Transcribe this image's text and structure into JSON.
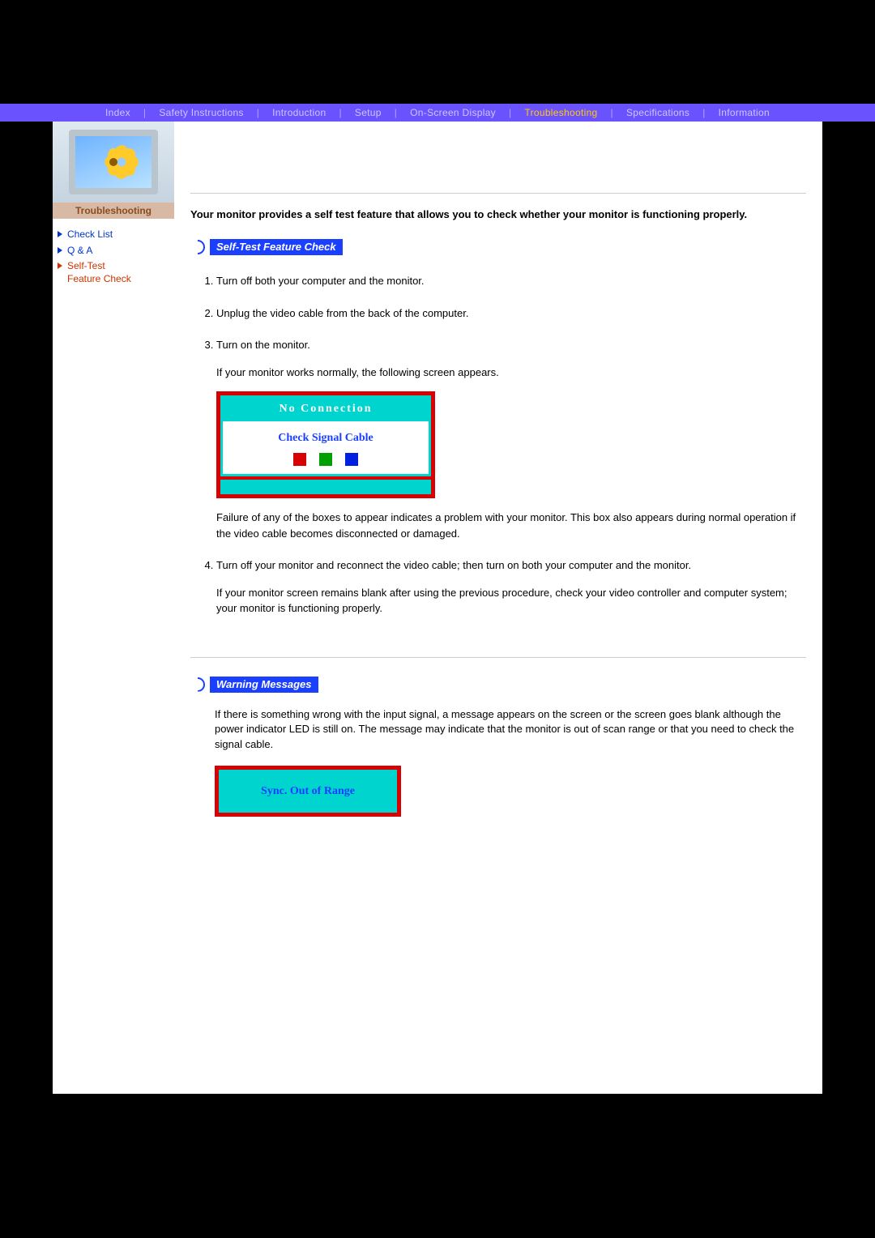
{
  "topnav": {
    "items": [
      {
        "label": "Index"
      },
      {
        "label": "Safety Instructions"
      },
      {
        "label": "Introduction"
      },
      {
        "label": "Setup"
      },
      {
        "label": "On-Screen Display"
      },
      {
        "label": "Troubleshooting",
        "active": true
      },
      {
        "label": "Specifications"
      },
      {
        "label": "Information"
      }
    ]
  },
  "sidebar": {
    "title": "Troubleshooting",
    "items": [
      {
        "label": "Check List"
      },
      {
        "label": "Q & A"
      },
      {
        "label": "Self-Test\nFeature Check",
        "active": true
      }
    ]
  },
  "content": {
    "intro": "Your monitor provides a self test feature that allows you to check whether your monitor is functioning properly.",
    "section1_title": "Self-Test Feature Check",
    "steps": {
      "s1": "Turn off both your computer and the monitor.",
      "s2": "Unplug the video cable from the back of the computer.",
      "s3": "Turn on the monitor.",
      "s3_sub1": "If your monitor works normally, the following screen appears.",
      "no_conn_title": "No Connection",
      "no_conn_check": "Check Signal Cable",
      "s3_sub2": "Failure of any of the boxes to appear indicates a problem with your monitor. This box also appears during normal operation if the video cable becomes disconnected or damaged.",
      "s4": "Turn off your monitor and reconnect the video cable; then turn on both your computer and the monitor.",
      "s4_sub": "If your monitor screen remains blank after using the previous procedure, check your video controller and computer system; your monitor is functioning properly."
    },
    "section2_title": "Warning Messages",
    "warn_para": "If there is something wrong with the input signal, a message appears on the screen or the screen goes blank although the power indicator LED is still on. The message may indicate that the monitor is out of scan range or that you need to check the signal cable.",
    "sync_text": "Sync. Out of Range"
  }
}
